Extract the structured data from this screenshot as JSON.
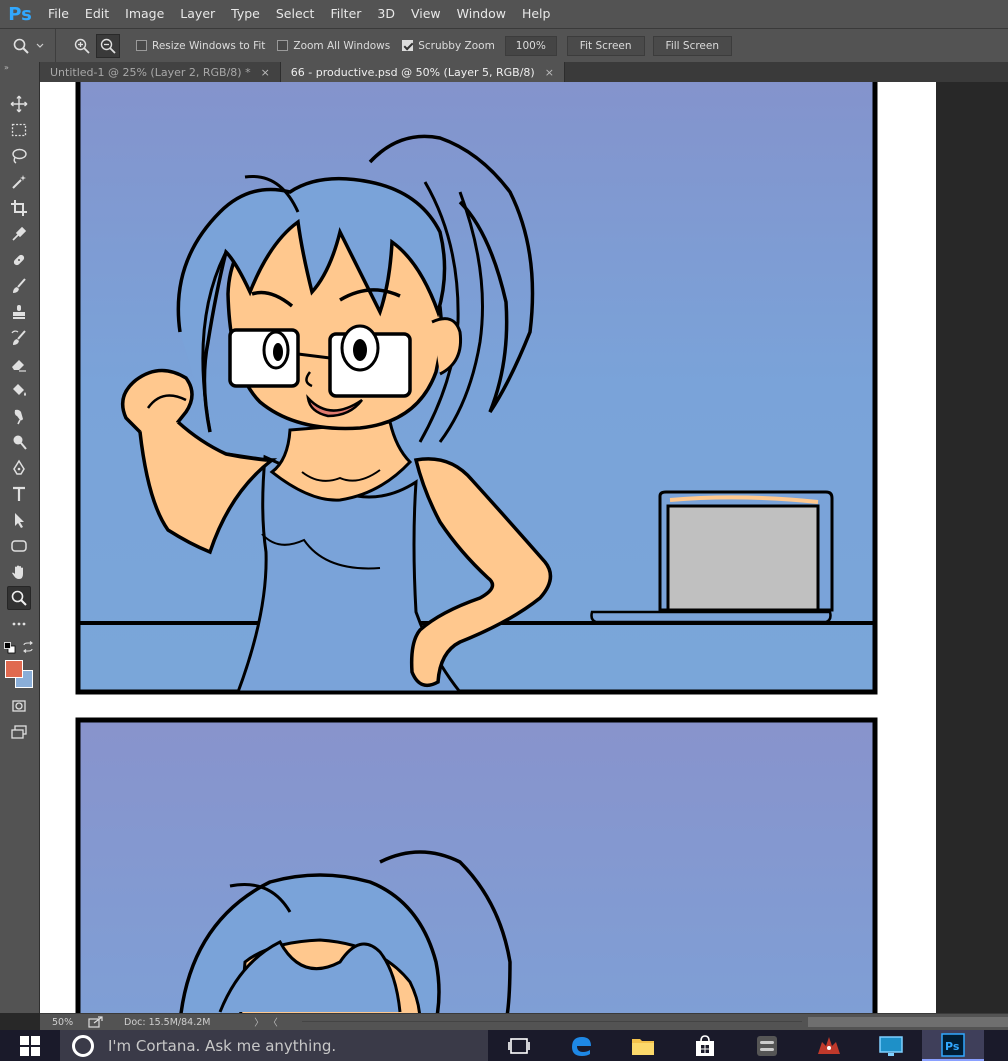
{
  "app": {
    "logo": "Ps"
  },
  "menu": [
    "File",
    "Edit",
    "Image",
    "Layer",
    "Type",
    "Select",
    "Filter",
    "3D",
    "View",
    "Window",
    "Help"
  ],
  "options": {
    "resize_windows": {
      "label": "Resize Windows to Fit",
      "checked": false
    },
    "zoom_all": {
      "label": "Zoom All Windows",
      "checked": false
    },
    "scrubby": {
      "label": "Scrubby Zoom",
      "checked": true
    },
    "zoom_value": "100%",
    "fit_screen": "Fit Screen",
    "fill_screen": "Fill Screen"
  },
  "tabs": [
    {
      "label": "Untitled-1 @ 25% (Layer 2, RGB/8) *",
      "close": "×",
      "active": false
    },
    {
      "label": "66 - productive.psd @ 50% (Layer 5, RGB/8)",
      "close": "×",
      "active": true
    }
  ],
  "toolbar": {
    "top_marker": "»"
  },
  "colors": {
    "foreground": "#e06a50",
    "background": "#8aaed8",
    "sky": "#7fa4d6",
    "skin": "#ffc88e"
  },
  "status": {
    "zoom": "50%",
    "doc": "Doc: 15.5M/84.2M",
    "arrow": "〉",
    "arrow_left": "〈"
  },
  "taskbar": {
    "cortana_placeholder": "I'm Cortana. Ask me anything."
  }
}
